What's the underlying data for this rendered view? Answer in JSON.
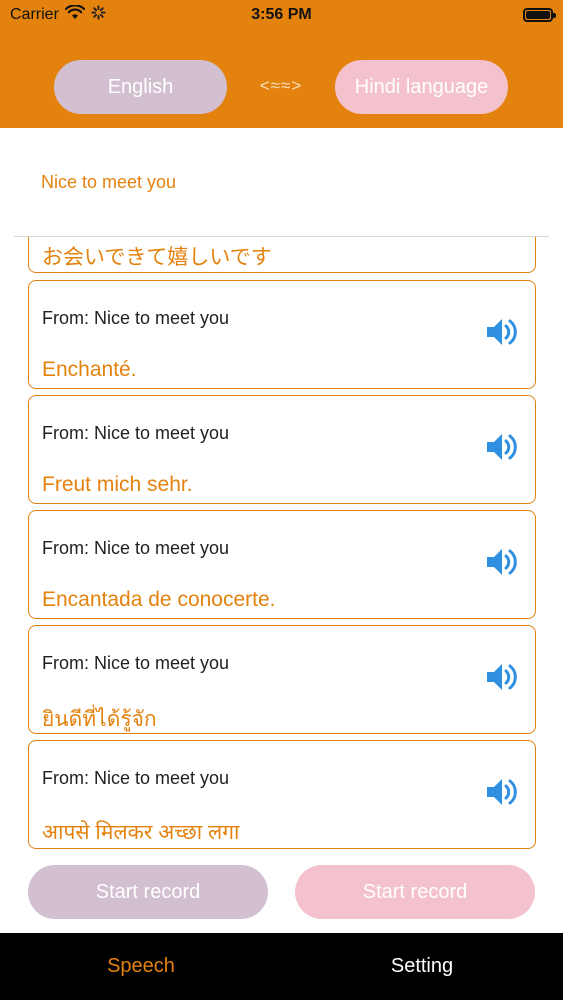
{
  "status_bar": {
    "carrier": "Carrier",
    "time": "3:56 PM"
  },
  "header": {
    "source_language": "English",
    "swap_symbol": "<≈≈>",
    "target_language": "Hindi language"
  },
  "input": {
    "text": "Nice to meet you"
  },
  "results": {
    "partial": {
      "translation": "お会いできて嬉しいです"
    },
    "items": [
      {
        "from": "From: Nice to meet you",
        "translation": "Enchanté."
      },
      {
        "from": "From: Nice to meet you",
        "translation": "Freut mich sehr."
      },
      {
        "from": "From: Nice to meet you",
        "translation": "Encantada de conocerte."
      },
      {
        "from": "From: Nice to meet you",
        "translation": " ยินดีที่ได้รู้จัก"
      },
      {
        "from": "From: Nice to meet you",
        "translation": "आपसे मिलकर अच्छा लगा"
      }
    ]
  },
  "record": {
    "left_label": "Start record",
    "right_label": "Start record"
  },
  "tabs": {
    "speech": "Speech",
    "setting": "Setting"
  },
  "colors": {
    "accent": "#e4820e",
    "speaker_blue": "#2f8fe0",
    "pill_mauve": "#d2bfcf",
    "pill_pink": "#f4c2cd"
  }
}
